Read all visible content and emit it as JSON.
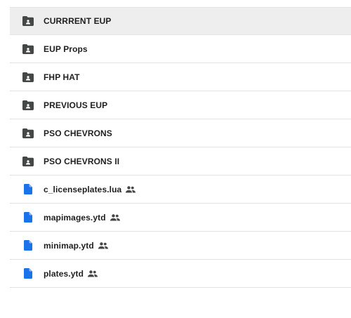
{
  "items": [
    {
      "name": "CURRRENT EUP",
      "type": "shared-folder",
      "icon": "shared-folder-icon",
      "selected": true
    },
    {
      "name": "EUP Props",
      "type": "shared-folder",
      "icon": "shared-folder-icon"
    },
    {
      "name": "FHP HAT",
      "type": "shared-folder",
      "icon": "shared-folder-icon"
    },
    {
      "name": "PREVIOUS EUP",
      "type": "shared-folder",
      "icon": "shared-folder-icon"
    },
    {
      "name": "PSO CHEVRONS",
      "type": "shared-folder",
      "icon": "shared-folder-icon"
    },
    {
      "name": "PSO CHEVRONS II",
      "type": "shared-folder",
      "icon": "shared-folder-icon"
    },
    {
      "name": "c_licenseplates.lua",
      "type": "file",
      "icon": "document-icon",
      "shared_badge": "people-icon"
    },
    {
      "name": "mapimages.ytd",
      "type": "file",
      "icon": "document-icon",
      "shared_badge": "people-icon"
    },
    {
      "name": "minimap.ytd",
      "type": "file",
      "icon": "document-icon",
      "shared_badge": "people-icon"
    },
    {
      "name": "plates.ytd",
      "type": "file",
      "icon": "document-icon",
      "shared_badge": "people-icon"
    }
  ],
  "colors": {
    "folder": "#444746",
    "file": "#1a73e8",
    "text": "#1f1f1f",
    "selected_row": "#eeeeee",
    "divider": "#e3e3e3"
  }
}
